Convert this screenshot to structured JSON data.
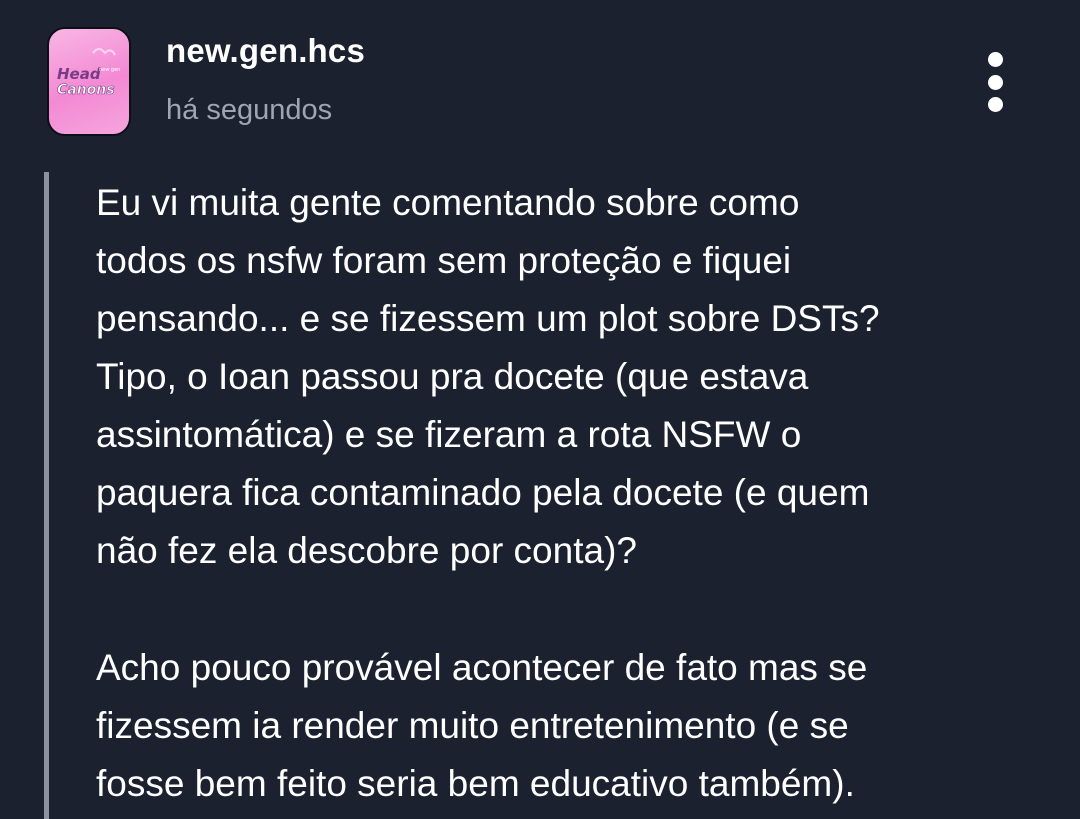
{
  "post": {
    "author": {
      "username": "new.gen.hcs",
      "avatar_text_line1": "Head",
      "avatar_text_line2": "Canons",
      "avatar_small_text": "new gen"
    },
    "timestamp": "há segundos",
    "more_options_icon": "vertical-ellipsis-icon",
    "paragraphs": [
      {
        "lines": [
          "Eu vi muita gente comentando sobre como",
          "todos os nsfw foram sem proteção e fiquei",
          "pensando... e se fizessem um plot sobre DSTs?",
          "Tipo, o Ioan passou pra docete (que estava",
          "assintomática) e se fizeram a rota NSFW o",
          "paquera fica contaminado pela docete (e quem",
          "não fez ela descobre por conta)?"
        ]
      },
      {
        "lines": [
          "Acho pouco provável acontecer de fato mas se",
          "fizessem ia render muito entretenimento (e se",
          "fosse bem feito seria bem educativo também)."
        ]
      }
    ]
  },
  "colors": {
    "background": "#1c2130",
    "text": "#ffffff",
    "muted_text": "#9ea5b4",
    "quote_bar": "#8c92a0",
    "avatar_pink": "#f389d4"
  }
}
